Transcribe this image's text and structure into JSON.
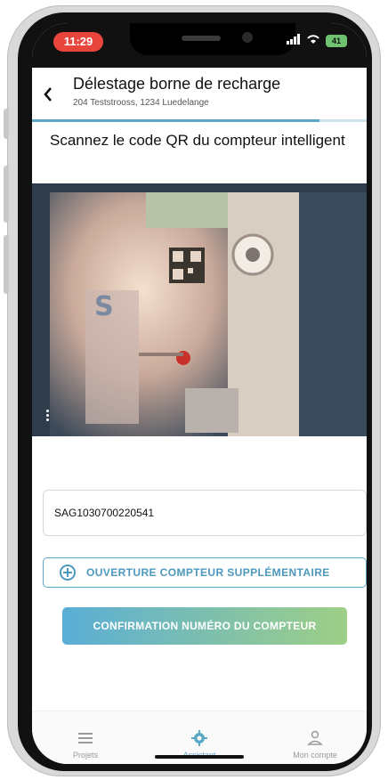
{
  "status": {
    "time": "11:29",
    "battery": "41"
  },
  "header": {
    "title": "Délestage borne de recharge",
    "subtitle": "204 Teststrooss, 1234 Luedelange",
    "progress": 0.86
  },
  "instruction": "Scannez le code QR du compteur intelligent",
  "meter_input": {
    "value": "SAG1030700220541"
  },
  "buttons": {
    "additional_meter": "OUVERTURE COMPTEUR SUPPLÉMENTAIRE",
    "confirm": "CONFIRMATION NUMÉRO DU COMPTEUR"
  },
  "nav": {
    "items": [
      {
        "label": "Projets",
        "icon": "menu-icon"
      },
      {
        "label": "Assistant",
        "icon": "gear-icon"
      },
      {
        "label": "Mon compte",
        "icon": "user-icon"
      }
    ]
  },
  "colors": {
    "accent": "#5aa7c6",
    "time_pill": "#e8453c",
    "gradient_start": "#5aaed7",
    "gradient_end": "#9ecf86"
  }
}
